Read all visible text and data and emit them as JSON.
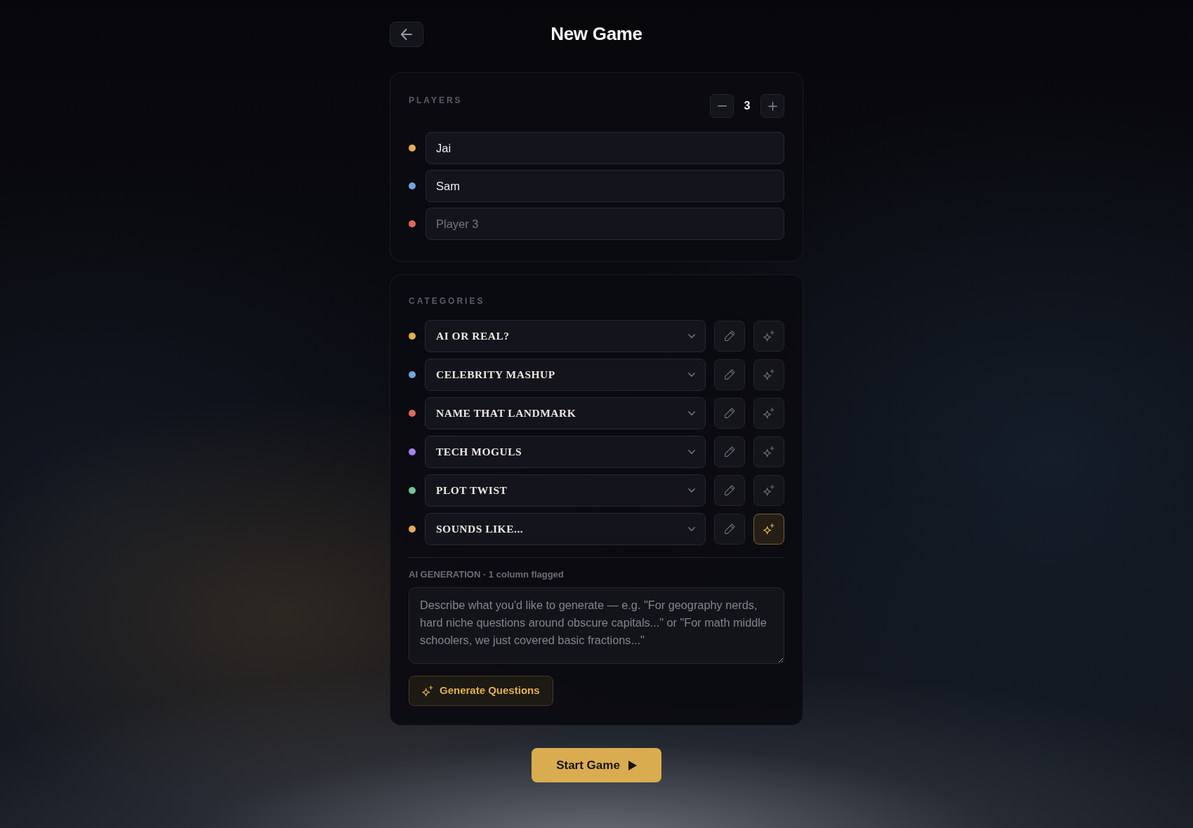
{
  "header": {
    "title": "New Game"
  },
  "players": {
    "label": "PLAYERS",
    "count": "3",
    "items": [
      {
        "value": "Jai",
        "color": "#e2b04f"
      },
      {
        "value": "Sam",
        "color": "#6fa6db"
      },
      {
        "placeholder": "Player 3",
        "color": "#e0695a"
      }
    ]
  },
  "categories": {
    "label": "CATEGORIES",
    "items": [
      {
        "name": "AI OR REAL?",
        "color": "#e2b04f",
        "flagged": false
      },
      {
        "name": "CELEBRITY MASHUP",
        "color": "#6fa6db",
        "flagged": false
      },
      {
        "name": "NAME THAT LANDMARK",
        "color": "#e0695a",
        "flagged": false
      },
      {
        "name": "TECH MOGULS",
        "color": "#a184e8",
        "flagged": false
      },
      {
        "name": "PLOT TWIST",
        "color": "#6cc79a",
        "flagged": false
      },
      {
        "name": "SOUNDS LIKE...",
        "color": "#e6a95c",
        "flagged": true
      }
    ]
  },
  "ai_generation": {
    "label": "AI GENERATION · 1 column flagged",
    "placeholder": "Describe what you'd like to generate — e.g. \"For geography nerds, hard niche questions around obscure capitals...\" or \"For math middle schoolers, we just covered basic fractions...\"",
    "button": "Generate Questions"
  },
  "start_button": "Start Game"
}
